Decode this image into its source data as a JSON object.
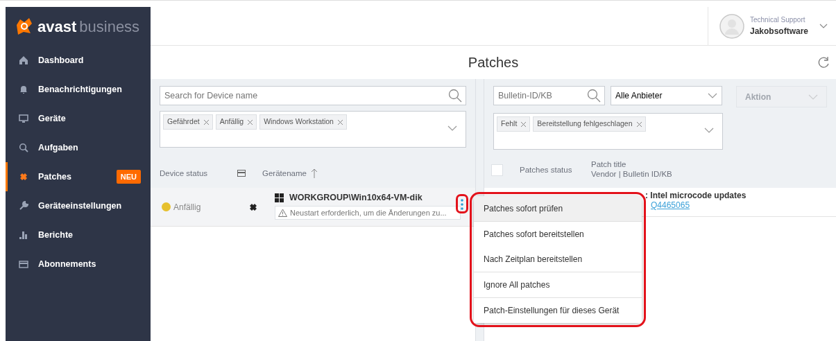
{
  "brand": {
    "name": "avast",
    "suffix": "business"
  },
  "sidebar": {
    "items": [
      {
        "label": "Dashboard",
        "selected": false
      },
      {
        "label": "Benachrichtigungen",
        "selected": false
      },
      {
        "label": "Geräte",
        "selected": false
      },
      {
        "label": "Aufgaben",
        "selected": false
      },
      {
        "label": "Patches",
        "selected": true,
        "badge": "NEU"
      },
      {
        "label": "Geräteeinstellungen",
        "selected": false
      },
      {
        "label": "Berichte",
        "selected": false
      },
      {
        "label": "Abonnements",
        "selected": false
      }
    ]
  },
  "user": {
    "role": "Technical Support",
    "name": "Jakobsoftware"
  },
  "page_title": "Patches",
  "devices": {
    "search": {
      "placeholder": "Search for Device name"
    },
    "filter_tags": [
      "Gefährdet",
      "Anfällig",
      "Windows Workstation"
    ],
    "columns": [
      "Device status",
      "Gerätename"
    ],
    "rows": [
      {
        "status": "Anfällig",
        "color": "#e6c02e",
        "name": "WORKGROUP\\Win10x64-VM-dik",
        "warning": "Neustart erforderlich, um die Änderungen zu...",
        "highlighted": true
      }
    ]
  },
  "patches": {
    "search": {
      "placeholder": "Bulletin-ID/KB"
    },
    "vendor": "Alle Anbieter",
    "action": {
      "label": "Aktion",
      "disabled": true
    },
    "filter_tags": [
      "Fehlt",
      "Bereitstellung fehlgeschlagen"
    ],
    "select_all": {
      "checked": false
    },
    "columns": [
      "Patches status",
      "Patch title",
      "Vendor | Bulletin ID/KB"
    ],
    "rows": [
      {
        "title": ": Intel microcode updates",
        "link": "Q4465065"
      }
    ]
  },
  "context_menu": {
    "highlighted": true,
    "items": [
      {
        "label": "Patches sofort prüfen",
        "selected": true,
        "separator_after": true
      },
      {
        "label": "Patches sofort bereitstellen",
        "selected": false,
        "separator_after": false
      },
      {
        "label": "Nach Zeitplan bereitstellen",
        "selected": false,
        "separator_after": true
      },
      {
        "label": "Ignore All patches",
        "selected": false,
        "separator_after": true
      },
      {
        "label": "Patch-Einstellungen für dieses Gerät",
        "selected": false,
        "separator_after": false
      }
    ]
  }
}
